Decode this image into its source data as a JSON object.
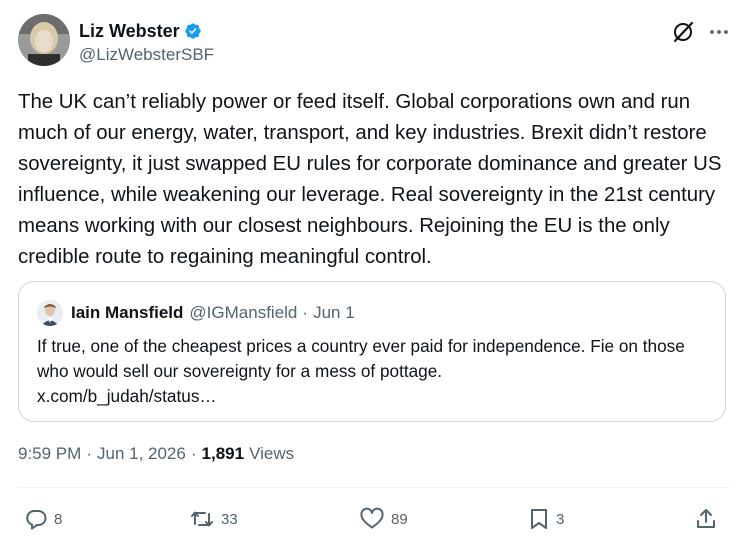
{
  "author": {
    "display_name": "Liz Webster",
    "handle": "@LizWebsterSBF",
    "verified": true
  },
  "tweet": {
    "text": "The UK can’t reliably power or feed itself. Global corporations own and run much of our energy, water, transport, and key industries. Brexit didn’t restore sovereignty, it just swapped EU rules for corporate dominance and greater US influence, while weakening our leverage. Real sovereignty in the 21st century means working with our closest neighbours. Rejoining the EU is the only credible route to regaining meaningful control."
  },
  "quote": {
    "display_name": "Iain Mansfield",
    "handle": "@IGMansfield",
    "separator": "·",
    "date": "Jun 1",
    "text": "If true, one of the cheapest prices a country ever paid for independence. Fie on those who would sell our sovereignty for a mess of pottage.",
    "link": "x.com/b_judah/status…"
  },
  "meta": {
    "time": "9:59 PM",
    "date": "Jun 1, 2026",
    "separator": "·",
    "views_count": "1,891",
    "views_label": "Views"
  },
  "actions": {
    "replies": "8",
    "reposts": "33",
    "likes": "89",
    "bookmarks": "3"
  },
  "icons": [
    "verified-badge-icon",
    "grok-icon",
    "more-icon",
    "reply-icon",
    "repost-icon",
    "like-icon",
    "bookmark-icon",
    "share-icon"
  ],
  "colors": {
    "verified_blue": "#1d9bf0",
    "secondary_text": "#536471",
    "border": "#cfd9de"
  }
}
